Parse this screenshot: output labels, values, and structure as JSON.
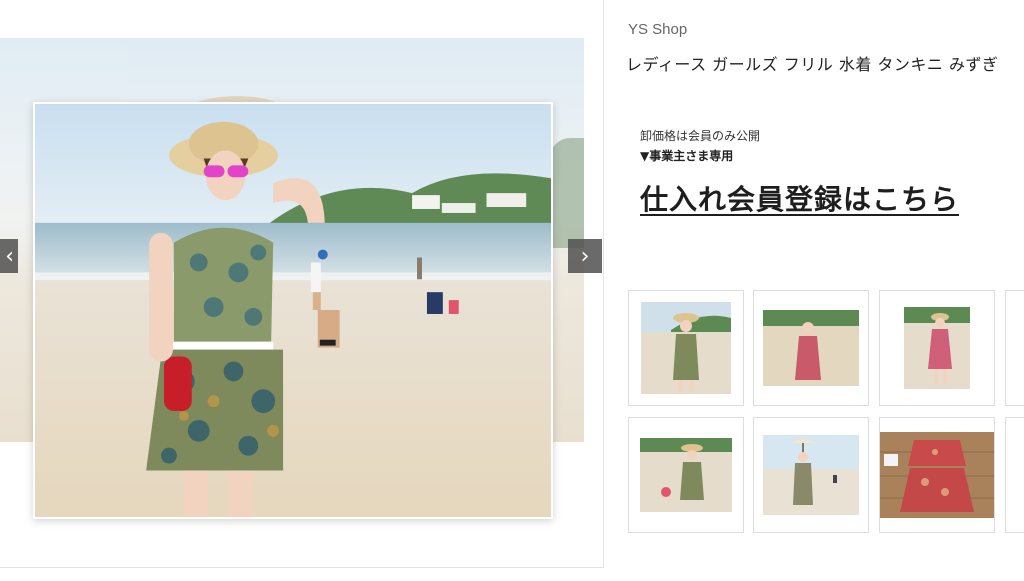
{
  "gallery": {
    "main_image_icon": "beach-swimwear-photo",
    "prev_icon": "chevron-left-icon",
    "next_icon": "chevron-right-icon",
    "prev_glyph": "‹",
    "next_glyph": "›"
  },
  "shop": {
    "name": "YS Shop"
  },
  "product": {
    "title": "レディース ガールズ フリル  水着  タンキニ  みずぎ"
  },
  "wholesale": {
    "note": "卸価格は会員のみ公開",
    "business_only": "▼事業主さま専用",
    "register_link": "仕入れ会員登録はこちら"
  },
  "thumbnails": [
    {
      "name": "thumb-beach-hat-pose",
      "style": "beach"
    },
    {
      "name": "thumb-red-dress",
      "style": "beach-red"
    },
    {
      "name": "thumb-red-dress-walk",
      "style": "beach-red2"
    },
    {
      "name": "thumb-partial-1",
      "style": "partial"
    },
    {
      "name": "thumb-beach-flowers",
      "style": "beach"
    },
    {
      "name": "thumb-umbrella",
      "style": "sky"
    },
    {
      "name": "thumb-flatlay-red",
      "style": "flatlay"
    },
    {
      "name": "thumb-partial-2",
      "style": "partial-wood"
    }
  ],
  "colors": {
    "arrow_bg": "#505050",
    "thumb_border": "#dddddd",
    "link_text": "#1e1e1e"
  }
}
